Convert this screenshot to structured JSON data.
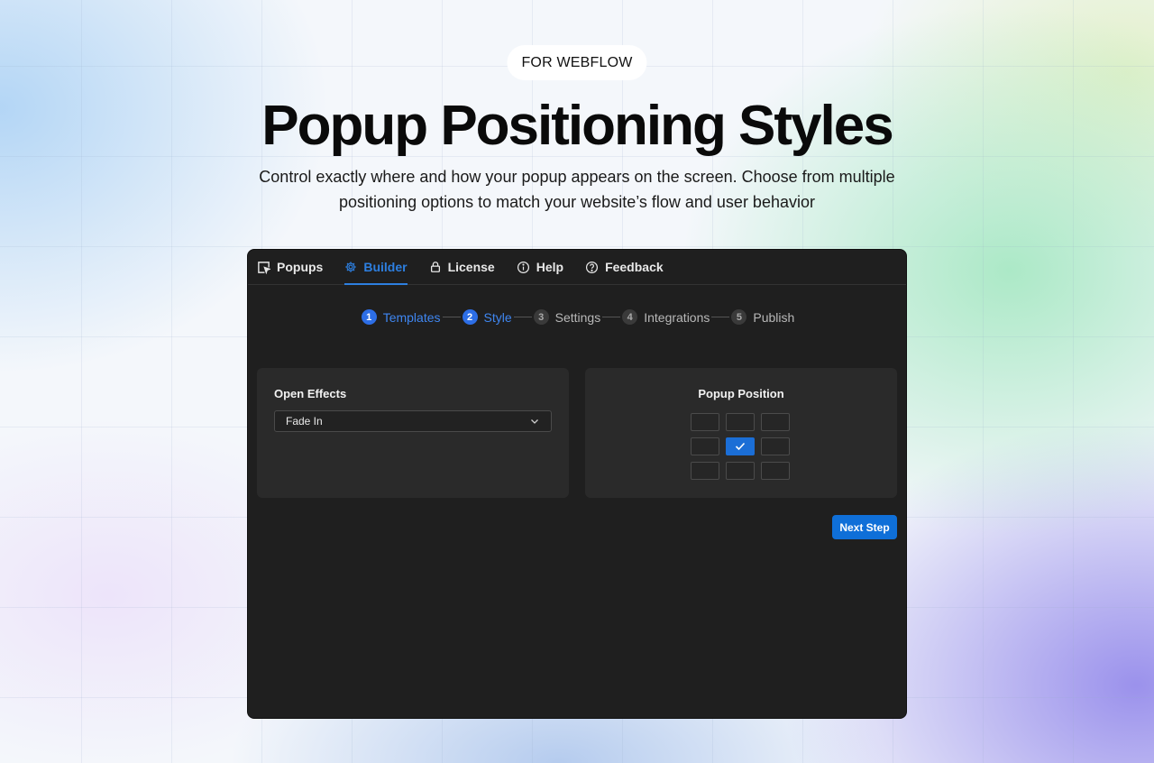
{
  "hero": {
    "badge": "FOR WEBFLOW",
    "title": "Popup Positioning Styles",
    "subtitle_line1": "Control exactly where and how your popup appears on the screen. Choose from multiple",
    "subtitle_line2": "positioning options to match your website’s flow and user behavior"
  },
  "nav": {
    "items": [
      {
        "label": "Popups",
        "icon": "cursor-box-icon",
        "active": false
      },
      {
        "label": "Builder",
        "icon": "gear-icon",
        "active": true
      },
      {
        "label": "License",
        "icon": "lock-icon",
        "active": false
      },
      {
        "label": "Help",
        "icon": "info-icon",
        "active": false
      },
      {
        "label": "Feedback",
        "icon": "question-icon",
        "active": false
      }
    ]
  },
  "stepper": {
    "steps": [
      {
        "num": "1",
        "label": "Templates",
        "done": true
      },
      {
        "num": "2",
        "label": "Style",
        "done": true
      },
      {
        "num": "3",
        "label": "Settings",
        "done": false
      },
      {
        "num": "4",
        "label": "Integrations",
        "done": false
      },
      {
        "num": "5",
        "label": "Publish",
        "done": false
      }
    ]
  },
  "open_effects": {
    "title": "Open Effects",
    "selected": "Fade In"
  },
  "popup_position": {
    "title": "Popup Position",
    "selected_index": 4
  },
  "actions": {
    "next_label": "Next Step"
  },
  "colors": {
    "accent": "#1b6ed6",
    "panel": "#1f1f1f",
    "card": "#2a2a2a"
  }
}
